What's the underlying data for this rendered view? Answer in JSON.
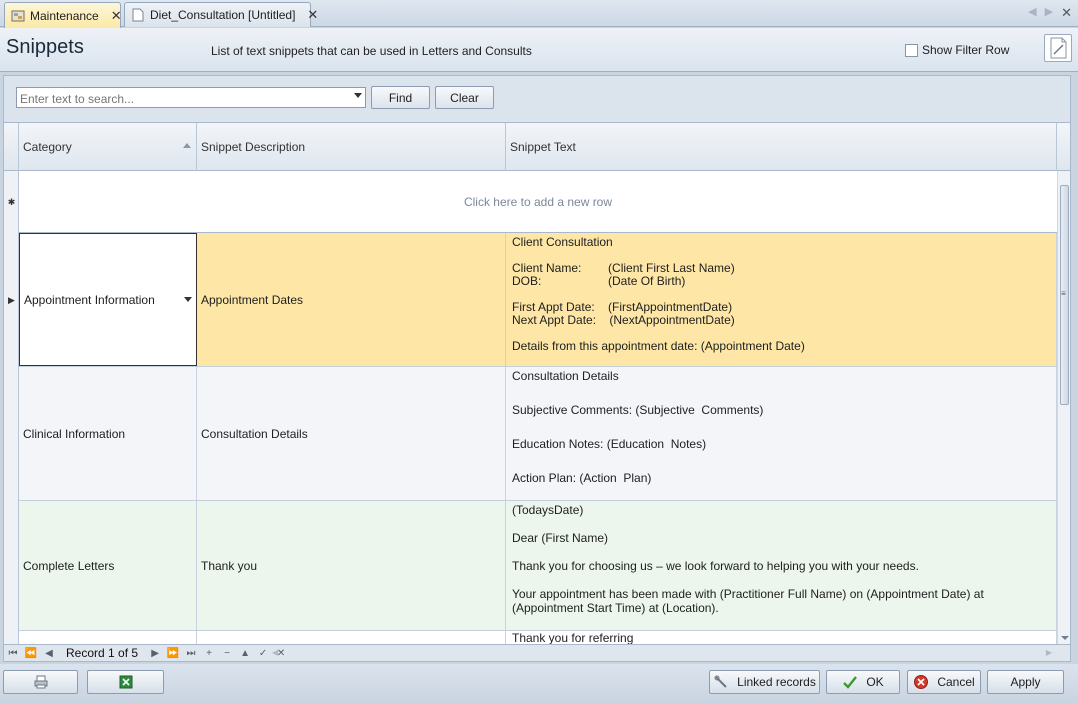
{
  "tabs": [
    {
      "label": "Maintenance",
      "close": "✕"
    },
    {
      "label": "Diet_Consultation [Untitled]",
      "close": "✕"
    }
  ],
  "strip_close": "✕",
  "header": {
    "title": "Snippets",
    "subtitle": "List of text snippets that can be used in Letters and Consults",
    "filter_row_label": "Show Filter Row"
  },
  "search": {
    "placeholder": "Enter text to search...",
    "find_label": "Find",
    "clear_label": "Clear"
  },
  "grid": {
    "columns": [
      "Category",
      "Snippet Description",
      "Snippet Text"
    ],
    "new_row_text": "Click here to add a new row",
    "rows": [
      {
        "category": "Appointment Information",
        "description": "Appointment Dates",
        "text_lines": [
          "Client Consultation",
          "",
          "Client Name:        (Client First Last Name)",
          "DOB:                    (Date Of Birth)",
          "",
          "First Appt Date:    (FirstAppointmentDate)",
          "Next Appt Date:    (NextAppointmentDate)",
          "",
          "Details from this appointment date: (Appointment Date)"
        ]
      },
      {
        "category": "Clinical Information",
        "description": "Consultation Details",
        "text_lines": [
          "Consultation Details",
          "",
          "",
          "Subjective Comments: (Subjective  Comments)",
          "",
          "",
          "Education Notes: (Education  Notes)",
          "",
          "",
          "Action Plan: (Action  Plan)"
        ]
      },
      {
        "category": "Complete Letters",
        "description": "Thank you",
        "text_lines": [
          "(TodaysDate)",
          "",
          "Dear (First Name)",
          "",
          "Thank you for choosing us – we look forward to helping you with your needs.",
          "",
          "Your appointment has been made with (Practitioner Full Name) on (Appointment Date) at",
          "(Appointment Start Time) at (Location)."
        ]
      },
      {
        "category": "",
        "description": "",
        "text_lines": [
          "Thank you for referring"
        ]
      }
    ]
  },
  "navigator": {
    "record_text": "Record 1 of 5"
  },
  "bottom": {
    "linked_label": "Linked records",
    "ok_label": "OK",
    "cancel_label": "Cancel",
    "apply_label": "Apply"
  },
  "colors": {
    "selected_row": "#fde6a6",
    "alt_row": "#ecf6ec",
    "accent_tab": "#fbe9a8"
  }
}
